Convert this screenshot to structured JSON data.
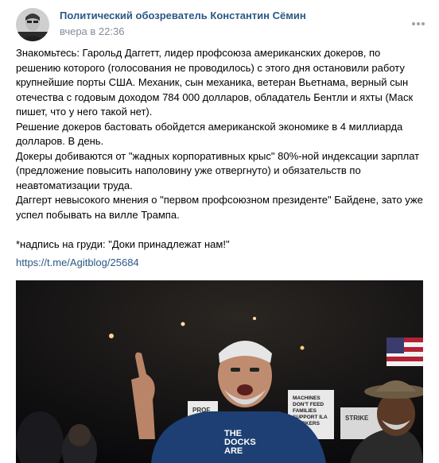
{
  "post": {
    "author": "Политический обозреватель Константин Сёмин",
    "time": "вчера в 22:36",
    "text": "Знакомьтесь: Гарольд Даггетт, лидер профсоюза американских докеров, по решению которого (голосования не проводилось) с этого дня остановили работу крупнейшие порты США. Механик, сын механика, ветеран Вьетнама, верный сын отечества с годовым доходом 784 000 долларов, обладатель Бентли и яхты (Маск пишет, что у него такой нет).\nРешение докеров бастовать обойдется американской экономике в 4 миллиарда долларов. В день.\nДокеры добиваются от \"жадных корпоративных крыс\" 80%-ной индексации зарплат (предложение повысить наполовину уже отвергнуто) и обязательств по неавтоматизации труда.\nДаггерт невысокого мнения о \"первом профсоюзном президенте\" Байдене, зато уже успел побывать на вилле Трампа.\n\n*надпись на груди: \"Доки принадлежат нам!\"",
    "link": "https://t.me/Agitblog/25684",
    "more_icon": "more-horizontal-icon",
    "photo": {
      "sign_left": "PROF",
      "sign_center": "MACHINES\nDON'T FEED\nFAMILIES\nSUPPORT ILA\nWORKERS",
      "sign_right": "STRIKE",
      "shirt_text": "THE\nDOCKS\nARE"
    }
  }
}
